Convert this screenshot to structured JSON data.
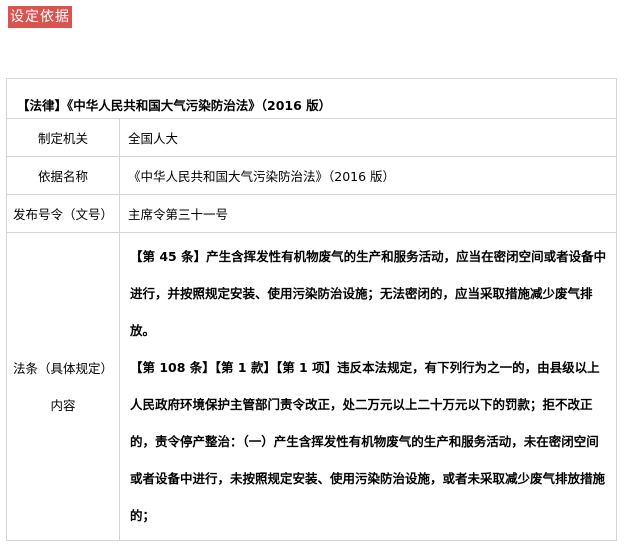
{
  "tag": {
    "label": "设定依据"
  },
  "table": {
    "heading": "【法律】《中华人民共和国大气污染防治法》（2016 版）",
    "rows": [
      {
        "label": "制定机关",
        "value": "全国人大"
      },
      {
        "label": "依据名称",
        "value": "《中华人民共和国大气污染防治法》（2016 版）"
      },
      {
        "label": "发布号令（文号）",
        "value": "主席令第三十一号"
      }
    ],
    "articles_label_line1": "法条（具体规定）",
    "articles_label_line2": "内容",
    "article_1": "【第 45 条】产生含挥发性有机物废气的生产和服务活动，应当在密闭空间或者设备中进行，并按照规定安装、使用污染防治设施；无法密闭的，应当采取措施减少废气排放。",
    "article_2": "【第 108 条】【第 1 款】【第 1 项】违反本法规定，有下列行为之一的，由县级以上人民政府环境保护主管部门责令改正，处二万元以上二十万元以下的罚款；拒不改正的，责令停产整治：（一）产生含挥发性有机物废气的生产和服务活动，未在密闭空间或者设备中进行，未按照规定安装、使用污染防治设施，或者未采取减少废气排放措施的；"
  }
}
